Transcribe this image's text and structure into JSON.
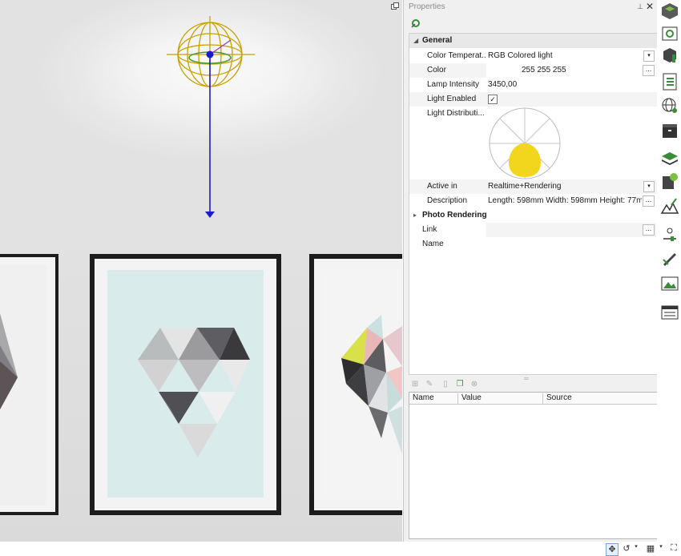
{
  "panel": {
    "title": "Properties",
    "pin_icon": "pin-icon",
    "close_icon": "close-icon"
  },
  "sections": {
    "general": "General",
    "photo_rendering": "Photo Rendering"
  },
  "props": {
    "color_temperature": {
      "label": "Color Temperat...",
      "value": "RGB Colored light"
    },
    "color": {
      "label": "Color",
      "value": "255 255 255"
    },
    "lamp_intensity": {
      "label": "Lamp Intensity",
      "value": "3450,00"
    },
    "light_enabled": {
      "label": "Light Enabled",
      "checked": true,
      "check_glyph": "✓"
    },
    "light_distribution": {
      "label": "Light Distributi..."
    },
    "active_in": {
      "label": "Active in",
      "value": "Realtime+Rendering"
    },
    "description": {
      "label": "Description",
      "value": "Length: 598mm Width: 598mm Height: 77m..."
    },
    "link": {
      "label": "Link",
      "value": ""
    },
    "name": {
      "label": "Name",
      "value": ""
    }
  },
  "ellipsis": "...",
  "dropdown_glyph": "▾",
  "bottom_table": {
    "columns": [
      "Name",
      "Value",
      "Source"
    ]
  },
  "colors": {
    "accent_blue": "#1a1ad0",
    "gizmo_gold": "#c8a000",
    "distribution_yellow": "#f2d61e",
    "sidebar_green": "#3c8a3c"
  },
  "sidebar_icons": [
    "cube-tools-icon",
    "book-search-icon",
    "object-info-icon",
    "list-icon",
    "globe-icon",
    "archive-icon",
    "layers-icon",
    "material-gear-icon",
    "terrain-icon",
    "light-adjust-icon",
    "pen-tool-icon",
    "image-icon",
    "panel-icon"
  ],
  "statusbar_icons": [
    "move-icon",
    "rotate-icon",
    "grid-icon",
    "fullscreen-icon"
  ]
}
